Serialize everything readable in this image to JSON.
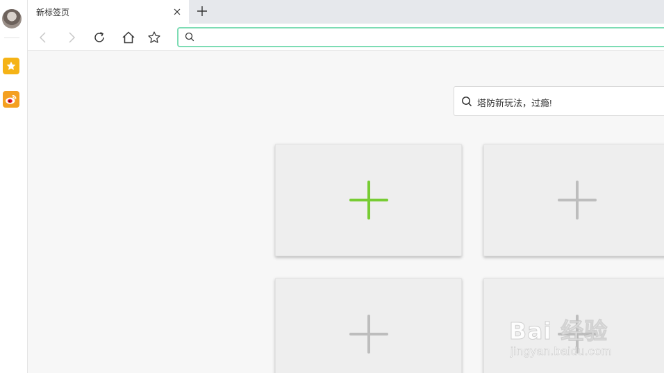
{
  "sidebar": {
    "avatar": "user-avatar",
    "apps": [
      {
        "name": "favorites-star-icon",
        "color": "#f5b316"
      },
      {
        "name": "weibo-icon",
        "color": "#f4a020"
      }
    ]
  },
  "tab": {
    "title": "新标签页",
    "close": "close-icon",
    "new_tab": "plus-icon"
  },
  "toolbar": {
    "back": "chevron-left-icon",
    "forward": "chevron-right-icon",
    "reload": "reload-icon",
    "home": "home-icon",
    "bookmark": "star-icon",
    "address_value": "",
    "address_placeholder": "",
    "address_focus_color": "#7ddcb4"
  },
  "content_search": {
    "text": "塔防新玩法，过瘾!"
  },
  "speed_dial": {
    "tiles": [
      {
        "icon": "add-icon",
        "color": "#77cc33"
      },
      {
        "icon": "add-icon",
        "color": "#bdbdbd"
      },
      {
        "icon": "add-icon",
        "color": "#bdbdbd"
      },
      {
        "icon": "add-icon",
        "color": "#bdbdbd"
      }
    ]
  },
  "watermark": {
    "logo": "Bai 经验",
    "url": "jingyan.baidu.com"
  }
}
